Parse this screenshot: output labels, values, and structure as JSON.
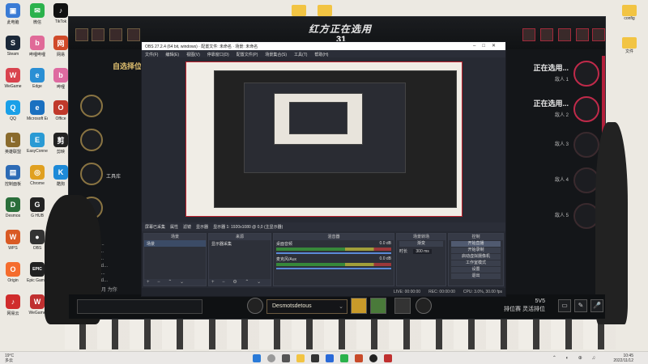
{
  "desktop": {
    "icons_left": [
      {
        "label": "此电脑",
        "glyph": "▣",
        "color": "#3a7bd5"
      },
      {
        "label": "Steam",
        "glyph": "S",
        "color": "#1b2838"
      },
      {
        "label": "WeGame",
        "glyph": "W",
        "color": "#d9434e"
      },
      {
        "label": "QQ",
        "glyph": "Q",
        "color": "#1aa0e8"
      },
      {
        "label": "英雄联盟",
        "glyph": "L",
        "color": "#8a6b2d"
      },
      {
        "label": "控制面板",
        "glyph": "▤",
        "color": "#2d6bb5"
      },
      {
        "label": "Desmos",
        "glyph": "D",
        "color": "#2a6e3a"
      },
      {
        "label": "WPS",
        "glyph": "W",
        "color": "#d95a24"
      },
      {
        "label": "Origin",
        "glyph": "O",
        "color": "#f56c2d"
      },
      {
        "label": "网易云",
        "glyph": "♪",
        "color": "#d02c2c"
      }
    ],
    "icons_col2": [
      {
        "label": "微信",
        "glyph": "✉",
        "color": "#2bb24c"
      },
      {
        "label": "哔哩哔哩",
        "glyph": "b",
        "color": "#e06a98"
      },
      {
        "label": "Edge",
        "glyph": "e",
        "color": "#2a8fd4"
      },
      {
        "label": "Microsoft Edge",
        "glyph": "e",
        "color": "#1a70c0"
      },
      {
        "label": "EasyConnect",
        "glyph": "E",
        "color": "#2a9ad4"
      },
      {
        "label": "Chrome",
        "glyph": "◎",
        "color": "#e0a020"
      },
      {
        "label": "G HUB",
        "glyph": "G",
        "color": "#222222"
      },
      {
        "label": "OBS",
        "glyph": "●",
        "color": "#333333"
      },
      {
        "label": "Epic Games",
        "glyph": "EPIC",
        "color": "#222222"
      },
      {
        "label": "WeGame",
        "glyph": "W",
        "color": "#c03030"
      }
    ],
    "icons_col3": [
      {
        "label": "TikTok",
        "glyph": "♪",
        "color": "#111111"
      },
      {
        "label": "网易",
        "glyph": "网",
        "color": "#d04a2a"
      },
      {
        "label": "哔哩",
        "glyph": "b",
        "color": "#de6aa0"
      },
      {
        "label": "Office",
        "glyph": "O",
        "color": "#c0392b"
      },
      {
        "label": "剪映",
        "glyph": "剪",
        "color": "#222222"
      },
      {
        "label": "酷狗",
        "glyph": "K",
        "color": "#1d8ad8"
      }
    ],
    "folder_right": "config",
    "folder_right2": "文件"
  },
  "game": {
    "title": "红方正在选用",
    "timer": "31",
    "logo": "自选择位",
    "left_panel_lines": [
      "QQ1547...",
      "LimeChi...",
      "Desmos...",
      "Desmotsd...",
      "Desmots...",
      "Desmotsd...",
      "聚聚的九月 为你"
    ],
    "tools_label": "工具库",
    "picks": [
      {
        "name": "正在选用...",
        "enemy": "敌人 1",
        "active": true
      },
      {
        "name": "正在选用...",
        "enemy": "敌人 2",
        "active": true
      },
      {
        "name": "",
        "enemy": "敌人 3",
        "active": false
      },
      {
        "name": "",
        "enemy": "敌人 4",
        "active": false
      },
      {
        "name": "",
        "enemy": "敌人 5",
        "active": false
      }
    ],
    "summoner_name": "Desmotsdetous",
    "mode_line1": "5V5",
    "mode_line2": "排位赛 灵活排位",
    "chat_placeholder": ""
  },
  "obs": {
    "title": "OBS 27.2.4 (64 bit, windows) · 配置文件: 未命名 · 场景: 未命名",
    "menu": [
      "文件(F)",
      "编辑(E)",
      "视图(V)",
      "停靠窗口(D)",
      "配置文件(P)",
      "场景集合(S)",
      "工具(T)",
      "帮助(H)"
    ],
    "toolbar": [
      "屏幕已采集",
      "属性",
      "滤镜",
      "显示器",
      "显示器 1: 1920x1080 @ 0,0 (主显示器)"
    ],
    "docks": {
      "scenes_title": "场景",
      "scenes": [
        "场景"
      ],
      "sources_title": "来源",
      "sources": [
        "显示器采集"
      ],
      "mixer_title": "混音器",
      "mixer": [
        {
          "name": "桌面音频",
          "db": "0.0 dB"
        },
        {
          "name": "麦克风/Aux",
          "db": "0.0 dB"
        }
      ],
      "transitions_title": "场景转场",
      "transition_type": "渐变",
      "duration_label": "时长",
      "duration": "300 ms",
      "controls_title": "控制",
      "controls": [
        "开始直播",
        "开始录制",
        "启动虚拟摄像机",
        "工作室模式",
        "设置",
        "退出"
      ]
    },
    "status": [
      "LIVE: 00:00:00",
      "REC: 00:00:00",
      "CPU: 3.0%, 30.00 fps"
    ]
  },
  "taskbar": {
    "weather_temp": "19°C",
    "weather_text": "多云",
    "time": "10:45",
    "date": "2022/11/12"
  }
}
